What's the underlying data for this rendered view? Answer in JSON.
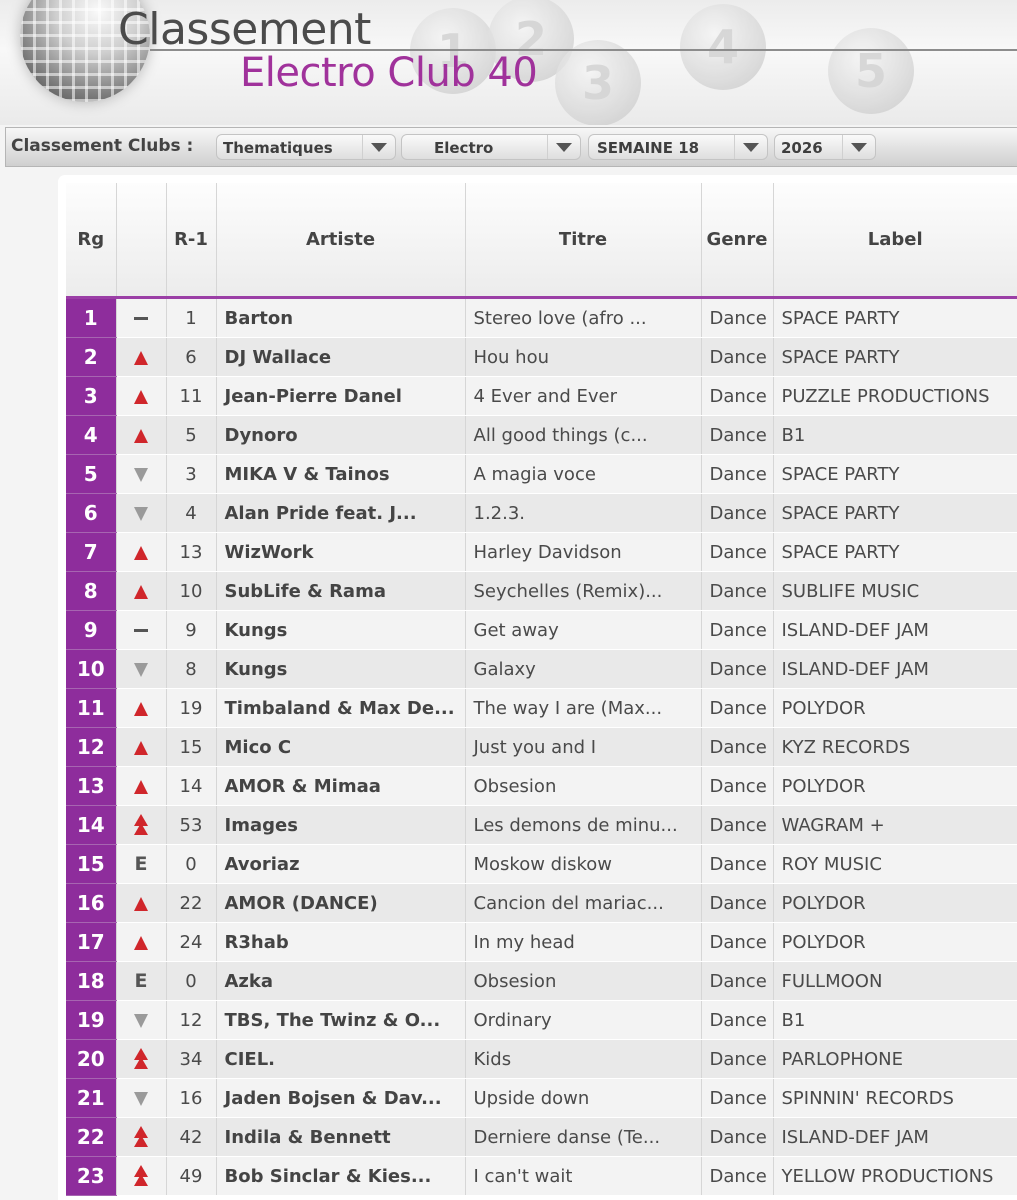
{
  "header": {
    "title_line1": "Classement",
    "title_line2": "Electro Club 40",
    "deco_numbers": [
      "1",
      "2",
      "3",
      "4",
      "5"
    ]
  },
  "filters": {
    "label": "Classement Clubs :",
    "category": "Thematiques",
    "theme": "Electro",
    "week": "SEMAINE 18",
    "year": "2026"
  },
  "columns": {
    "rank": "Rg",
    "previous": "R-1",
    "artist": "Artiste",
    "title": "Titre",
    "genre": "Genre",
    "label": "Label"
  },
  "colors": {
    "accent": "#8e2d9c",
    "up": "#d0262b",
    "down": "#9a9a9a"
  },
  "rows": [
    {
      "rank": "1",
      "move": "same",
      "prev": "1",
      "artist": "Barton",
      "title": "Stereo love (afro ...",
      "genre": "Dance",
      "label": "SPACE PARTY"
    },
    {
      "rank": "2",
      "move": "up",
      "prev": "6",
      "artist": "DJ Wallace",
      "title": "Hou hou",
      "genre": "Dance",
      "label": "SPACE PARTY"
    },
    {
      "rank": "3",
      "move": "up",
      "prev": "11",
      "artist": "Jean-Pierre Danel",
      "title": "4 Ever and Ever",
      "genre": "Dance",
      "label": "PUZZLE PRODUCTIONS"
    },
    {
      "rank": "4",
      "move": "up",
      "prev": "5",
      "artist": "Dynoro",
      "title": "All good things (c...",
      "genre": "Dance",
      "label": "B1"
    },
    {
      "rank": "5",
      "move": "down",
      "prev": "3",
      "artist": "MIKA V & Tainos",
      "title": "A magia voce",
      "genre": "Dance",
      "label": "SPACE PARTY"
    },
    {
      "rank": "6",
      "move": "down",
      "prev": "4",
      "artist": "Alan Pride feat. J...",
      "title": "1.2.3.",
      "genre": "Dance",
      "label": "SPACE PARTY"
    },
    {
      "rank": "7",
      "move": "up",
      "prev": "13",
      "artist": "WizWork",
      "title": "Harley Davidson",
      "genre": "Dance",
      "label": "SPACE PARTY"
    },
    {
      "rank": "8",
      "move": "up",
      "prev": "10",
      "artist": "SubLife & Rama",
      "title": "Seychelles (Remix)...",
      "genre": "Dance",
      "label": "SUBLIFE MUSIC"
    },
    {
      "rank": "9",
      "move": "same",
      "prev": "9",
      "artist": "Kungs",
      "title": "Get away",
      "genre": "Dance",
      "label": "ISLAND-DEF JAM"
    },
    {
      "rank": "10",
      "move": "down",
      "prev": "8",
      "artist": "Kungs",
      "title": "Galaxy",
      "genre": "Dance",
      "label": "ISLAND-DEF JAM"
    },
    {
      "rank": "11",
      "move": "up",
      "prev": "19",
      "artist": "Timbaland & Max De...",
      "title": "The way I are (Max...",
      "genre": "Dance",
      "label": "POLYDOR"
    },
    {
      "rank": "12",
      "move": "up",
      "prev": "15",
      "artist": "Mico C",
      "title": "Just you and I",
      "genre": "Dance",
      "label": "KYZ RECORDS"
    },
    {
      "rank": "13",
      "move": "up",
      "prev": "14",
      "artist": "AMOR & Mimaa",
      "title": "Obsesion",
      "genre": "Dance",
      "label": "POLYDOR"
    },
    {
      "rank": "14",
      "move": "double-up",
      "prev": "53",
      "artist": "Images",
      "title": "Les demons de minu...",
      "genre": "Dance",
      "label": "WAGRAM +"
    },
    {
      "rank": "15",
      "move": "new",
      "prev": "0",
      "artist": "Avoriaz",
      "title": "Moskow diskow",
      "genre": "Dance",
      "label": "ROY MUSIC"
    },
    {
      "rank": "16",
      "move": "up",
      "prev": "22",
      "artist": "AMOR (DANCE)",
      "title": "Cancion del mariac...",
      "genre": "Dance",
      "label": "POLYDOR"
    },
    {
      "rank": "17",
      "move": "up",
      "prev": "24",
      "artist": "R3hab",
      "title": "In my head",
      "genre": "Dance",
      "label": "POLYDOR"
    },
    {
      "rank": "18",
      "move": "new",
      "prev": "0",
      "artist": "Azka",
      "title": "Obsesion",
      "genre": "Dance",
      "label": "FULLMOON"
    },
    {
      "rank": "19",
      "move": "down",
      "prev": "12",
      "artist": "TBS, The Twinz & O...",
      "title": "Ordinary",
      "genre": "Dance",
      "label": "B1"
    },
    {
      "rank": "20",
      "move": "double-up",
      "prev": "34",
      "artist": "CIEL.",
      "title": "Kids",
      "genre": "Dance",
      "label": "PARLOPHONE"
    },
    {
      "rank": "21",
      "move": "down",
      "prev": "16",
      "artist": "Jaden Bojsen & Dav...",
      "title": "Upside down",
      "genre": "Dance",
      "label": "SPINNIN' RECORDS"
    },
    {
      "rank": "22",
      "move": "double-up",
      "prev": "42",
      "artist": "Indila & Bennett",
      "title": "Derniere danse (Te...",
      "genre": "Dance",
      "label": "ISLAND-DEF JAM"
    },
    {
      "rank": "23",
      "move": "double-up",
      "prev": "49",
      "artist": "Bob Sinclar & Kies...",
      "title": "I can't wait",
      "genre": "Dance",
      "label": "YELLOW PRODUCTIONS"
    }
  ]
}
